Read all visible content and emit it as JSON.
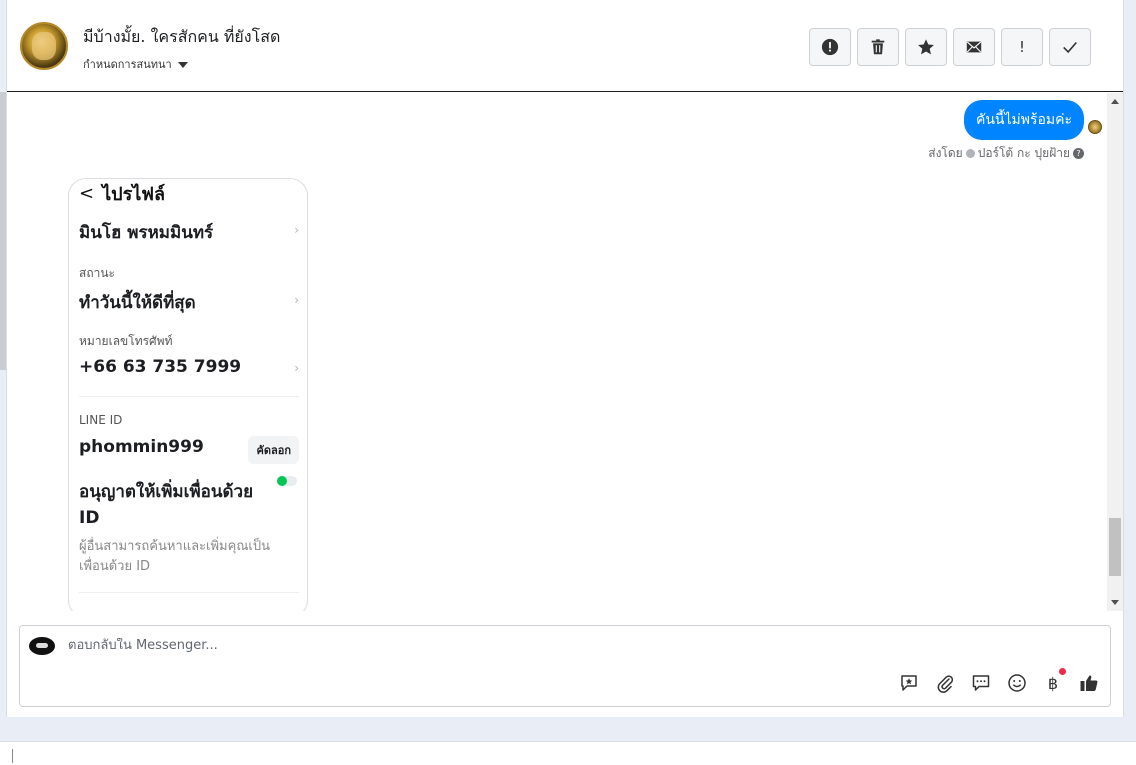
{
  "header": {
    "title": "มีบ้างมั้ย. ใครสักคน ที่ยังโสด",
    "subtitle": "กำหนดการสนทนา"
  },
  "toolbar": {
    "buttons": [
      {
        "name": "alert-circle-icon"
      },
      {
        "name": "trash-icon"
      },
      {
        "name": "star-icon"
      },
      {
        "name": "envelope-icon"
      },
      {
        "name": "exclamation-icon",
        "label": "!"
      },
      {
        "name": "check-icon"
      }
    ]
  },
  "chat": {
    "message": "คันนี้ไม่พร้อมค่ะ",
    "sent_by_prefix": "ส่งโดย",
    "sent_by_name": "ปอร์โต้ กะ ปุยฝ้าย",
    "help": "?"
  },
  "profile_shot": {
    "header": "ไปรไฟล์",
    "back": "<",
    "name": "มินโฮ พรหมมินทร์",
    "status_label": "สถานะ",
    "status_value": "ทำวันนี้ให้ดีที่สุด",
    "phone_label": "หมายเลขโทรศัพท์",
    "phone_value": "+66 63 735 7999",
    "line_label": "LINE ID",
    "line_value": "phommin999",
    "copy_label": "คัดลอก",
    "allow_label": "อนุญาตให้เพิ่มเพื่อนด้วย ID",
    "allow_desc": "ผู้อื่นสามารถค้นหาและเพิ่มคุณเป็นเพื่อนด้วย ID",
    "arrow": "›"
  },
  "composer": {
    "placeholder": "ตอบกลับใน Messenger...",
    "actions": [
      "saved-reply-icon",
      "paperclip-icon",
      "chat-bubble-icon",
      "emoji-icon",
      "baht-icon",
      "thumbs-up-icon"
    ],
    "baht": "฿"
  }
}
